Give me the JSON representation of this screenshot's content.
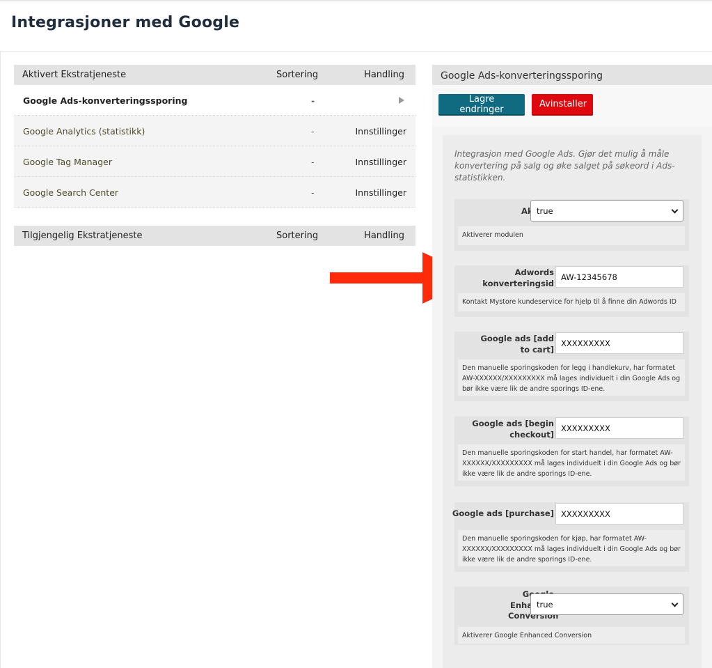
{
  "page": {
    "title": "Integrasjoner med Google"
  },
  "active_table": {
    "headers": {
      "name": "Aktivert Ekstratjeneste",
      "sort": "Sortering",
      "action": "Handling"
    },
    "rows": [
      {
        "name": "Google Ads-konverteringssporing",
        "sort": "-",
        "action": ""
      },
      {
        "name": "Google Analytics (statistikk)",
        "sort": "-",
        "action": "Innstillinger"
      },
      {
        "name": "Google Tag Manager",
        "sort": "-",
        "action": "Innstillinger"
      },
      {
        "name": "Google Search Center",
        "sort": "-",
        "action": "Innstillinger"
      }
    ]
  },
  "available_table": {
    "headers": {
      "name": "Tilgjengelig Ekstratjeneste",
      "sort": "Sortering",
      "action": "Handling"
    }
  },
  "panel": {
    "title": "Google Ads-konverteringssporing",
    "save_label": "Lagre endringer",
    "uninstall_label": "Avinstaller",
    "intro": "Integrasjon med Google Ads. Gjør det mulig å måle konvertering på salg og øke salget på søkeord i Ads-statistikken.",
    "fields": [
      {
        "label": "Aktiver",
        "value": "true",
        "help": "Aktiverer modulen"
      },
      {
        "label": "Adwords konverteringsid",
        "value": "AW-12345678",
        "help": "Kontakt Mystore kundeservice for hjelp til å finne din Adwords ID"
      },
      {
        "label": "Google ads [add to cart]",
        "value": "XXXXXXXXX",
        "help": "Den manuelle sporingskoden for legg i handlekurv, har formatet AW-XXXXXX/XXXXXXXXX må lages individuelt i din Google Ads og bør ikke være lik de andre sporings ID-ene."
      },
      {
        "label": "Google ads [begin checkout]",
        "value": "XXXXXXXXX",
        "help": "Den manuelle sporingskoden for start handel, har formatet AW-XXXXXX/XXXXXXXXX må lages individuelt i din Google Ads og bør ikke være lik de andre sporings ID-ene."
      },
      {
        "label": "Google ads [purchase]",
        "value": "XXXXXXXXX",
        "help": "Den manuelle sporingskoden for kjøp, har formatet AW-XXXXXX/XXXXXXXXX må lages individuelt i din Google Ads og bør ikke være lik de andre sporings ID-ene."
      },
      {
        "label": "Google Enhanced Conversion",
        "value": "true",
        "help": "Aktiverer Google Enhanced Conversion"
      }
    ]
  },
  "colors": {
    "primary": "#106a80",
    "danger": "#e0080f",
    "annotation": "#ff2a0a"
  }
}
